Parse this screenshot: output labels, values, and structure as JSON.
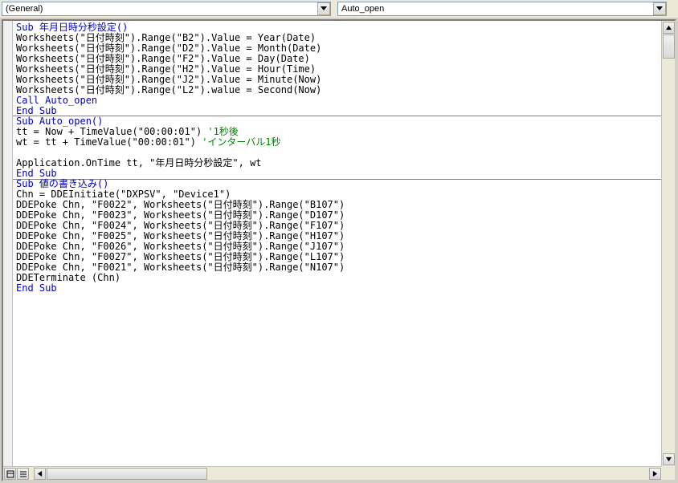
{
  "toolbar": {
    "object_combo": "(General)",
    "proc_combo": "Auto_open"
  },
  "code": {
    "sub1_header": "Sub 年月日時分秒設定()",
    "sub1_lines": [
      "Worksheets(\"日付時刻\").Range(\"B2\").Value = Year(Date)",
      "Worksheets(\"日付時刻\").Range(\"D2\").Value = Month(Date)",
      "Worksheets(\"日付時刻\").Range(\"F2\").Value = Day(Date)",
      "Worksheets(\"日付時刻\").Range(\"H2\").Value = Hour(Time)",
      "Worksheets(\"日付時刻\").Range(\"J2\").Value = Minute(Now)",
      "Worksheets(\"日付時刻\").Range(\"L2\").walue = Second(Now)"
    ],
    "sub1_call": "Call Auto_open",
    "end_sub": "End Sub",
    "sub2_header": "Sub Auto_open()",
    "sub2_l1a": "tt = Now + TimeValue(\"00:00:01\") ",
    "sub2_l1b": "'1秒後",
    "sub2_l2a": "wt = tt + TimeValue(\"00:00:01\") ",
    "sub2_l2b": "'インターバル1秒",
    "sub2_blank": "",
    "sub2_l3": "Application.OnTime tt, \"年月日時分秒設定\", wt",
    "sub3_header": "Sub 値の書き込み()",
    "sub3_lines": [
      "Chn = DDEInitiate(\"DXPSV\", \"Device1\")",
      "DDEPoke Chn, \"F0022\", Worksheets(\"日付時刻\").Range(\"B107\")",
      "DDEPoke Chn, \"F0023\", Worksheets(\"日付時刻\").Range(\"D107\")",
      "DDEPoke Chn, \"F0024\", Worksheets(\"日付時刻\").Range(\"F107\")",
      "DDEPoke Chn, \"F0025\", Worksheets(\"日付時刻\").Range(\"H107\")",
      "DDEPoke Chn, \"F0026\", Worksheets(\"日付時刻\").Range(\"J107\")",
      "DDEPoke Chn, \"F0027\", Worksheets(\"日付時刻\").Range(\"L107\")",
      "DDEPoke Chn, \"F0021\", Worksheets(\"日付時刻\").Range(\"N107\")",
      "DDETerminate (Chn)"
    ]
  }
}
